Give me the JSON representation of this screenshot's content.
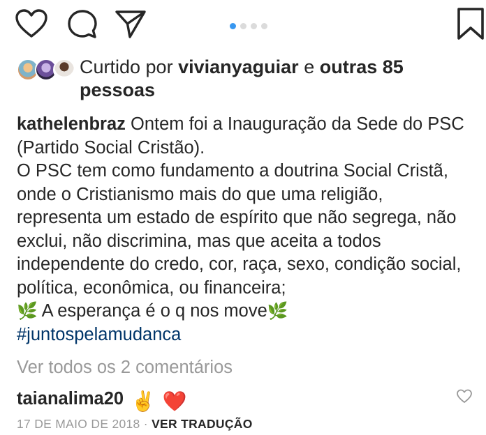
{
  "actions": {
    "like_icon": "heart-icon",
    "comment_icon": "comment-icon",
    "share_icon": "paper-plane-icon",
    "save_icon": "bookmark-icon",
    "carousel_dots": 4,
    "carousel_active": 1
  },
  "likes": {
    "prefix": "Curtido por",
    "user": "vivianyaguiar",
    "joiner": "e",
    "others": "outras 85",
    "others_suffix": "pessoas"
  },
  "caption": {
    "author": "kathelenbraz",
    "line1": "Ontem foi a Inauguração da Sede do PSC (Partido Social Cristão).",
    "line2": "O PSC tem como fundamento a doutrina Social Cristã, onde o Cristianismo mais do que uma religião, representa um estado de espírito que não segrega, não exclui, não discrimina, mas que aceita a todos independente do credo, cor, raça, sexo, condição social, política, econômica, ou financeira;",
    "leaf_emoji": "🌿",
    "line3": " A esperança é o q nos move",
    "hashtag": "#juntospelamudanca"
  },
  "view_comments": "Ver todos os 2 comentários",
  "comment": {
    "user": "taianalima20",
    "emoji1": "✌️",
    "emoji2": "❤️"
  },
  "meta": {
    "date": "17 DE MAIO DE 2018",
    "separator": "·",
    "translate": "VER TRADUÇÃO"
  },
  "colors": {
    "text": "#262626",
    "muted": "#999999",
    "link": "#003569",
    "dot_active": "#3897f0"
  }
}
